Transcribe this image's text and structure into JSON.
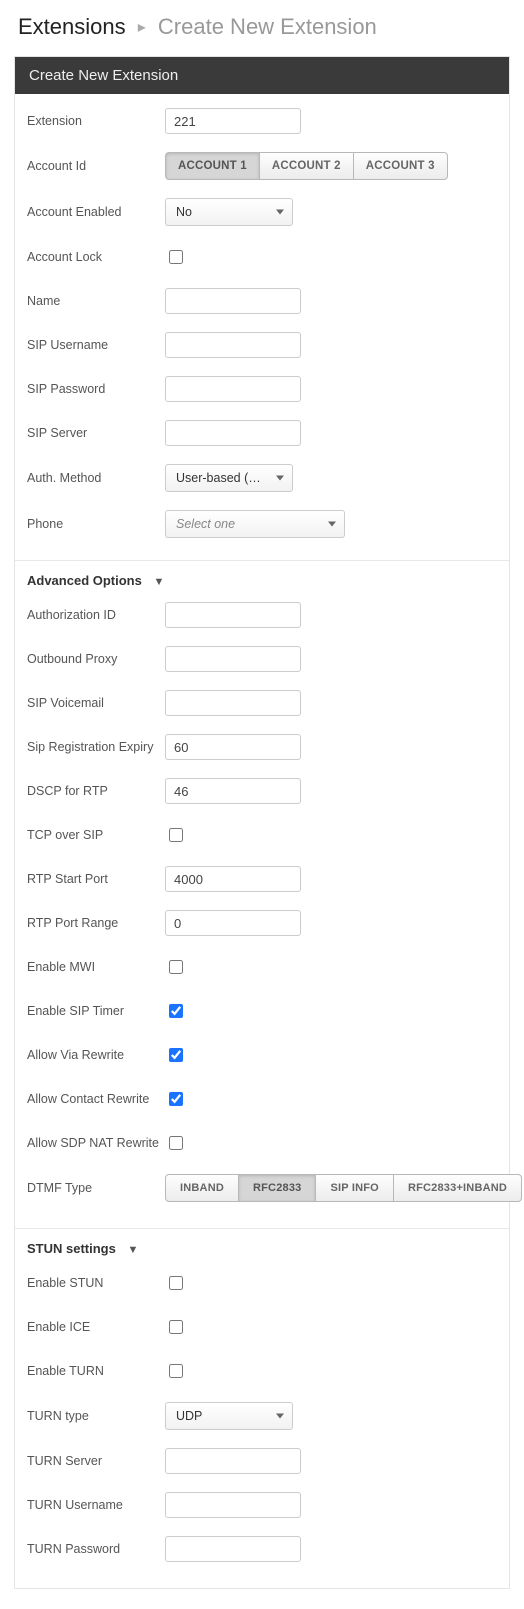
{
  "breadcrumb": {
    "root": "Extensions",
    "current": "Create New Extension"
  },
  "panel": {
    "title": "Create New Extension"
  },
  "fields": {
    "extension_label": "Extension",
    "extension_value": "221",
    "account_id_label": "Account Id",
    "account_tabs": [
      "ACCOUNT 1",
      "ACCOUNT 2",
      "ACCOUNT 3"
    ],
    "account_enabled_label": "Account Enabled",
    "account_enabled_value": "No",
    "account_lock_label": "Account Lock",
    "name_label": "Name",
    "name_value": "",
    "sip_username_label": "SIP Username",
    "sip_username_value": "",
    "sip_password_label": "SIP Password",
    "sip_password_value": "",
    "sip_server_label": "SIP Server",
    "sip_server_value": "",
    "auth_method_label": "Auth. Method",
    "auth_method_value": "User-based (most …",
    "phone_label": "Phone",
    "phone_value": "Select one"
  },
  "advanced": {
    "title": "Advanced Options",
    "auth_id_label": "Authorization ID",
    "auth_id_value": "",
    "outbound_proxy_label": "Outbound Proxy",
    "outbound_proxy_value": "",
    "sip_voicemail_label": "SIP Voicemail",
    "sip_voicemail_value": "",
    "sip_reg_expiry_label": "Sip Registration Expiry",
    "sip_reg_expiry_value": "60",
    "dscp_rtp_label": "DSCP for RTP",
    "dscp_rtp_value": "46",
    "tcp_over_sip_label": "TCP over SIP",
    "rtp_start_label": "RTP Start Port",
    "rtp_start_value": "4000",
    "rtp_range_label": "RTP Port Range",
    "rtp_range_value": "0",
    "enable_mwi_label": "Enable MWI",
    "enable_sip_timer_label": "Enable SIP Timer",
    "allow_via_rewrite_label": "Allow Via Rewrite",
    "allow_contact_rewrite_label": "Allow Contact Rewrite",
    "allow_sdp_nat_rewrite_label": "Allow SDP NAT Rewrite",
    "dtmf_type_label": "DTMF Type",
    "dtmf_options": [
      "INBAND",
      "RFC2833",
      "SIP INFO",
      "RFC2833+INBAND"
    ]
  },
  "stun": {
    "title": "STUN settings",
    "enable_stun_label": "Enable STUN",
    "enable_ice_label": "Enable ICE",
    "enable_turn_label": "Enable TURN",
    "turn_type_label": "TURN type",
    "turn_type_value": "UDP",
    "turn_server_label": "TURN Server",
    "turn_server_value": "",
    "turn_username_label": "TURN Username",
    "turn_username_value": "",
    "turn_password_label": "TURN Password",
    "turn_password_value": ""
  }
}
